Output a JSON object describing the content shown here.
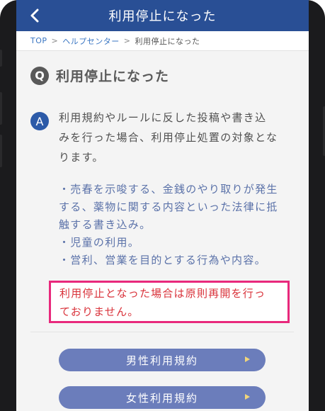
{
  "header": {
    "title": "利用停止になった",
    "back_icon": "chevron-left-icon",
    "background": "#294f95"
  },
  "breadcrumb": {
    "items": [
      "TOP",
      "ヘルプセンター",
      "利用停止になった"
    ],
    "separator": ">"
  },
  "question": {
    "badge": "Q",
    "text": "利用停止になった"
  },
  "answer": {
    "badge": "A",
    "lines": [
      "利用規約やルールに反した投稿や書き込",
      "みを行った場合、利用停止処置の対象とな",
      "ります。"
    ],
    "rules": [
      "・売春を示唆する、金銭のやり取りが発生",
      "する、薬物に関する内容といった法律に抵",
      "触する書き込み。",
      "・児童の利用。",
      "・営利、営業を目的とする行為や内容。"
    ]
  },
  "notice": {
    "lines": [
      "利用停止となった場合は原則再開を行っ",
      "ておりません。"
    ],
    "border_color": "#e8297c",
    "text_color": "#d9323a"
  },
  "buttons": {
    "male_terms": "男性利用規約",
    "female_terms": "女性利用規約",
    "arrow_icon": "triangle-right-icon"
  }
}
